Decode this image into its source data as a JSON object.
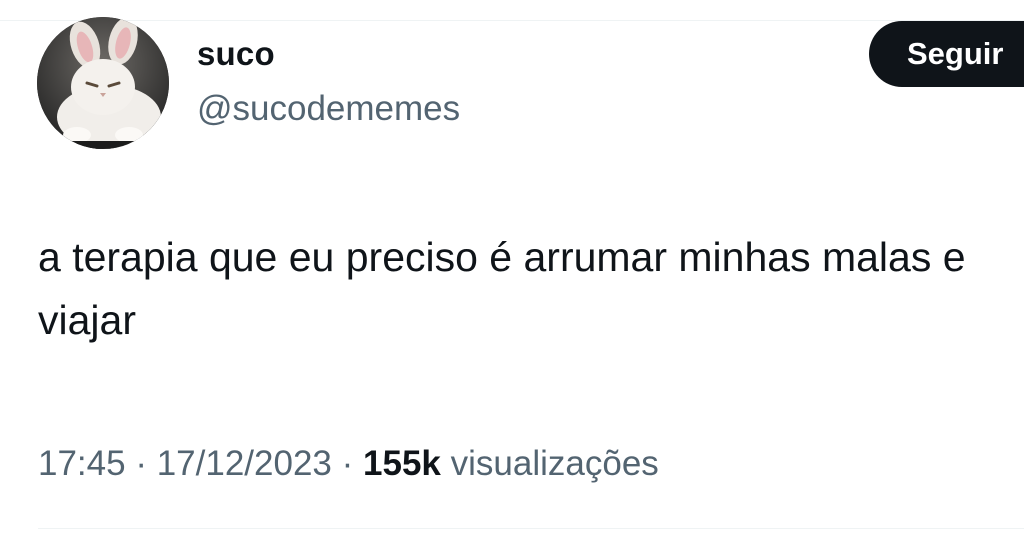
{
  "author": {
    "display_name": "suco",
    "handle": "@sucodememes",
    "avatar_icon": "fluffy-white-cat-with-bunny-ears-avatar"
  },
  "follow_button": {
    "label": "Seguir"
  },
  "tweet": {
    "text": "a terapia que eu preciso é arrumar minhas malas e viajar"
  },
  "meta": {
    "time": "17:45",
    "separator": "·",
    "date": "17/12/2023",
    "views_count": "155k",
    "views_label": "visualizações"
  },
  "colors": {
    "primary_text": "#0f1419",
    "secondary_text": "#536471",
    "button_bg": "#0f1419",
    "button_text": "#ffffff",
    "divider": "#eff3f4"
  }
}
